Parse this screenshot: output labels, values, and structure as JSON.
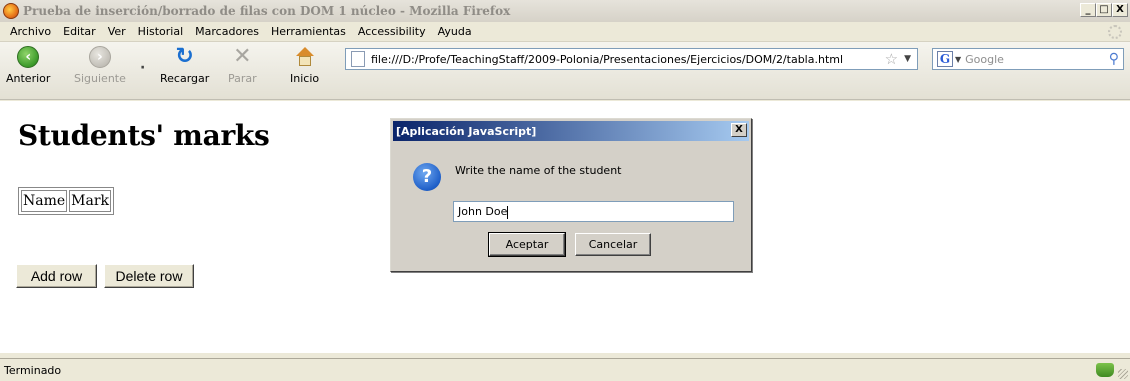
{
  "window": {
    "title": "Prueba de inserción/borrado de filas con DOM 1 núcleo - Mozilla Firefox",
    "min_label": "_",
    "max_label": "□",
    "close_label": "X"
  },
  "menu": {
    "items": [
      "Archivo",
      "Editar",
      "Ver",
      "Historial",
      "Marcadores",
      "Herramientas",
      "Accessibility",
      "Ayuda"
    ]
  },
  "toolbar": {
    "back_label": "Anterior",
    "forward_label": "Siguiente",
    "reload_label": "Recargar",
    "stop_label": "Parar",
    "home_label": "Inicio",
    "url": "file:///D:/Profe/TeachingStaff/2009-Polonia/Presentaciones/Ejercicios/DOM/2/tabla.html",
    "search_placeholder": "Google"
  },
  "page": {
    "heading": "Students' marks",
    "table_headers": [
      "Name",
      "Mark"
    ],
    "add_row_label": "Add row",
    "delete_row_label": "Delete row"
  },
  "dialog": {
    "title": "[Aplicación JavaScript]",
    "message": "Write the name of the student",
    "input_value": "John Doe",
    "ok_label": "Aceptar",
    "cancel_label": "Cancelar",
    "close_label": "X"
  },
  "status": {
    "text": "Terminado"
  }
}
